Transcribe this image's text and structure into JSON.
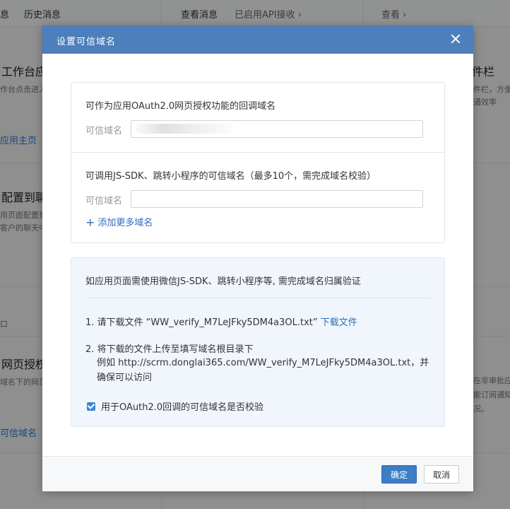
{
  "background": {
    "top_items": [
      "息",
      "历史消息",
      "查看消息",
      "已启用API接收 ›",
      "查看 ›"
    ],
    "left_col": {
      "title1": "工作台应",
      "desc1": "作台点击进入",
      "link1": "应用主页",
      "title2": "配置到聊",
      "desc2a": "用页面配置到",
      "desc2b": "客户的聊天中",
      "title3": "网页授权",
      "desc3": "域名下的网页",
      "link3": "可信域名",
      "stray": "口"
    },
    "right_col": {
      "title1": "件栏",
      "desc1a": "件栏，方便",
      "desc1b": "通效率",
      "desc2a": "在非审批应",
      "desc2b": "能订阅通知",
      "desc2c": "况。"
    }
  },
  "dialog": {
    "title": "设置可信域名",
    "oauth_section": {
      "title": "可作为应用OAuth2.0网页授权功能的回调域名",
      "label": "可信域名",
      "value": ""
    },
    "jssdk_section": {
      "title": "可调用JS-SDK、跳转小程序的可信域名（最多10个，需完成域名校验）",
      "label": "可信域名",
      "value": "",
      "add_more": "添加更多域名"
    },
    "info": {
      "heading": "如应用页面需使用微信JS-SDK、跳转小程序等, 需完成域名归属验证",
      "step1_prefix": "1. 请下载文件 “WW_verify_M7LeJFky5DM4a3OL.txt”",
      "step1_link": "下载文件",
      "step2": "2. 将下载的文件上传至填写域名根目录下",
      "example": "例如 http://scrm.donglai365.com/WW_verify_M7LeJFky5DM4a3OL.txt，并确保可以访问",
      "checkbox_label": "用于OAuth2.0回调的可信域名是否校验",
      "checkbox_checked": true
    },
    "buttons": {
      "ok": "确定",
      "cancel": "取消"
    }
  },
  "colors": {
    "header": "#4c7fbc",
    "link": "#2d6dbf",
    "primary_button": "#3c7ec6",
    "info_bg": "#f1f6fc"
  }
}
